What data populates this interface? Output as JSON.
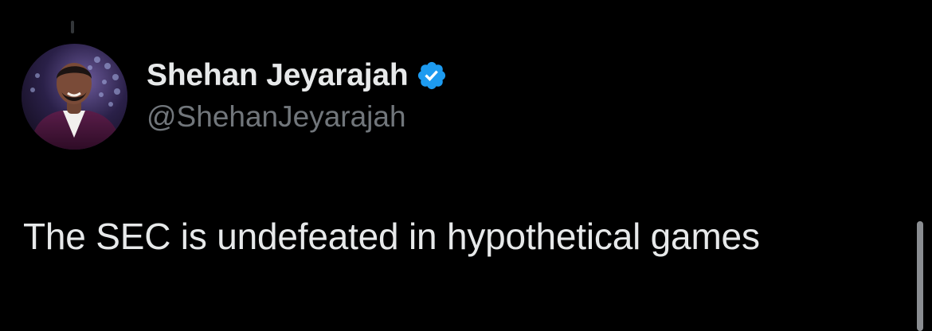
{
  "tweet": {
    "author": {
      "display_name": "Shehan Jeyarajah",
      "handle": "@ShehanJeyarajah",
      "verified": true,
      "verified_icon": "verified-badge-icon",
      "avatar_icon": "profile-photo"
    },
    "text": "The SEC is undefeated in hypothetical games"
  },
  "colors": {
    "background": "#000000",
    "primary_text": "#e7e9ea",
    "secondary_text": "#71767b",
    "verified_blue": "#1d9bf0"
  }
}
